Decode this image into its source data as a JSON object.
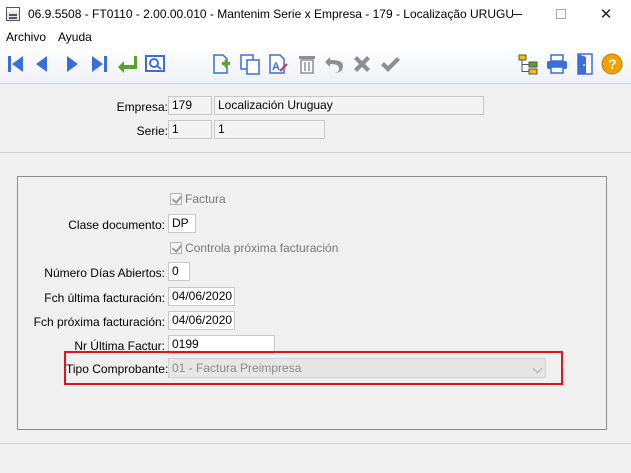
{
  "window": {
    "title": "06.9.5508 - FT0110 - 2.00.00.010 - Mantenim Serie x Empresa - 179 - Localização URUGU...",
    "close_glyph": "✕"
  },
  "menu": {
    "items": [
      "Archivo",
      "Ayuda"
    ]
  },
  "toolbar": {
    "icons": [
      "first-record-icon",
      "previous-record-icon",
      "next-record-icon",
      "last-record-icon",
      "return-icon",
      "search-icon",
      "new-record-icon",
      "copy-icon",
      "edit-icon",
      "delete-icon",
      "undo-icon",
      "cancel-icon",
      "confirm-icon",
      "tree-icon",
      "print-icon",
      "exit-icon",
      "help-icon"
    ],
    "colors": {
      "blue": "#3a6fd8",
      "green": "#5aa02c",
      "gray": "#8c9096",
      "help": "#f2a100"
    }
  },
  "header": {
    "empresa_label": "Empresa:",
    "empresa_code": "179",
    "empresa_name": "Localización Uruguay",
    "serie_label": "Serie:",
    "serie_code": "1",
    "serie_name": "1"
  },
  "form": {
    "factura_label": "Factura",
    "clase_label": "Clase documento:",
    "clase_value": "DP",
    "controla_label": "Controla próxima facturación",
    "dias_label": "Número Días Abiertos:",
    "dias_value": "0",
    "ultima_label": "Fch última facturación:",
    "ultima_value": "04/06/2020",
    "proxima_label": "Fch próxima facturación:",
    "proxima_value": "04/06/2020",
    "nr_label": "Nr Última Factur:",
    "nr_value": "0199",
    "tipo_label": "Tipo Comprobante:",
    "tipo_value": "01 - Factura Preimpresa"
  },
  "highlight_color": "#e0141b"
}
